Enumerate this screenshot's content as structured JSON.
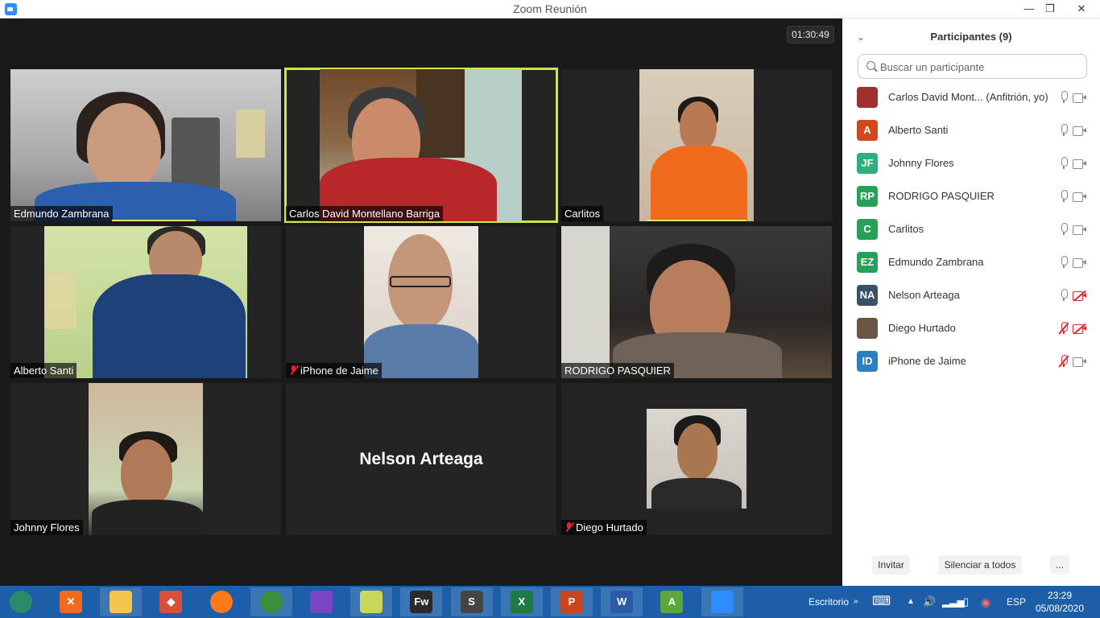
{
  "window": {
    "title": "Zoom Reunión"
  },
  "meeting": {
    "timer": "01:30:49",
    "tiles": [
      {
        "label": "Edmundo Zambrana",
        "muted": false,
        "active": false
      },
      {
        "label": "Carlos David Montellano Barriga",
        "muted": false,
        "active": true
      },
      {
        "label": "Carlitos",
        "muted": false,
        "active": false
      },
      {
        "label": "Alberto  Santi",
        "muted": false,
        "active": false
      },
      {
        "label": "iPhone de Jaime",
        "muted": true,
        "active": false
      },
      {
        "label": "RODRIGO PASQUIER",
        "muted": false,
        "active": false
      },
      {
        "label": "Johnny Flores",
        "muted": false,
        "active": false
      },
      {
        "label": "",
        "big_name": "Nelson Arteaga",
        "muted": false,
        "active": false
      },
      {
        "label": "Diego Hurtado",
        "muted": true,
        "active": false
      }
    ]
  },
  "participants": {
    "title": "Participantes (9)",
    "search_placeholder": "Buscar un participante",
    "list": [
      {
        "name": "Carlos David Mont...  (Anfitrión, yo)",
        "initials": "",
        "avatar_type": "photo",
        "color": "#a03030",
        "mic_muted": false,
        "video_off": false
      },
      {
        "name": "Alberto  Santi",
        "initials": "A",
        "avatar_type": "initials",
        "color": "#d14a1f",
        "mic_muted": false,
        "video_off": false
      },
      {
        "name": "Johnny Flores",
        "initials": "JF",
        "avatar_type": "initials",
        "color": "#2eae7a",
        "mic_muted": false,
        "video_off": false
      },
      {
        "name": "RODRIGO PASQUIER",
        "initials": "RP",
        "avatar_type": "initials",
        "color": "#27a05a",
        "mic_muted": false,
        "video_off": false
      },
      {
        "name": "Carlitos",
        "initials": "C",
        "avatar_type": "initials",
        "color": "#27a05a",
        "mic_muted": false,
        "video_off": false
      },
      {
        "name": "Edmundo Zambrana",
        "initials": "EZ",
        "avatar_type": "initials",
        "color": "#27a05a",
        "mic_muted": false,
        "video_off": false
      },
      {
        "name": "Nelson Arteaga",
        "initials": "NA",
        "avatar_type": "initials",
        "color": "#3a4f68",
        "mic_muted": false,
        "video_off": true
      },
      {
        "name": "Diego Hurtado",
        "initials": "",
        "avatar_type": "photo",
        "color": "#6a5544",
        "mic_muted": true,
        "video_off": true
      },
      {
        "name": "iPhone de Jaime",
        "initials": "ID",
        "avatar_type": "initials",
        "color": "#2a7fc2",
        "mic_muted": true,
        "video_off": false
      }
    ],
    "buttons": {
      "invite": "Invitar",
      "mute_all": "Silenciar a todos",
      "more": "..."
    }
  },
  "taskbar": {
    "apps": [
      {
        "name": "windows-start",
        "glyph": "",
        "color": "#2a8a6a",
        "open": false
      },
      {
        "name": "xampp",
        "glyph": "✕",
        "color": "#f06b20",
        "open": false
      },
      {
        "name": "file-explorer",
        "glyph": "",
        "color": "#f3c54a",
        "open": true
      },
      {
        "name": "git",
        "glyph": "◆",
        "color": "#d94f3a",
        "open": false
      },
      {
        "name": "firefox",
        "glyph": "",
        "color": "#ff7a1a",
        "open": false
      },
      {
        "name": "chrome",
        "glyph": "",
        "color": "#3a8f3a",
        "open": true
      },
      {
        "name": "visual-studio",
        "glyph": "",
        "color": "#7a45c4",
        "open": false
      },
      {
        "name": "notes",
        "glyph": "",
        "color": "#c9d65a",
        "open": true
      },
      {
        "name": "fireworks",
        "glyph": "Fw",
        "color": "#2a2a2a",
        "open": true
      },
      {
        "name": "sublime",
        "glyph": "S",
        "color": "#444444",
        "open": true
      },
      {
        "name": "excel",
        "glyph": "X",
        "color": "#1f7a45",
        "open": true
      },
      {
        "name": "powerpoint",
        "glyph": "P",
        "color": "#c9451f",
        "open": true
      },
      {
        "name": "word",
        "glyph": "W",
        "color": "#2a5aa8",
        "open": true
      },
      {
        "name": "android-studio",
        "glyph": "A",
        "color": "#5aa83a",
        "open": false
      },
      {
        "name": "zoom",
        "glyph": "",
        "color": "#2d8cff",
        "open": true
      }
    ],
    "desktop_label": "Escritorio",
    "language": "ESP",
    "time": "23:29",
    "date": "05/08/2020"
  }
}
